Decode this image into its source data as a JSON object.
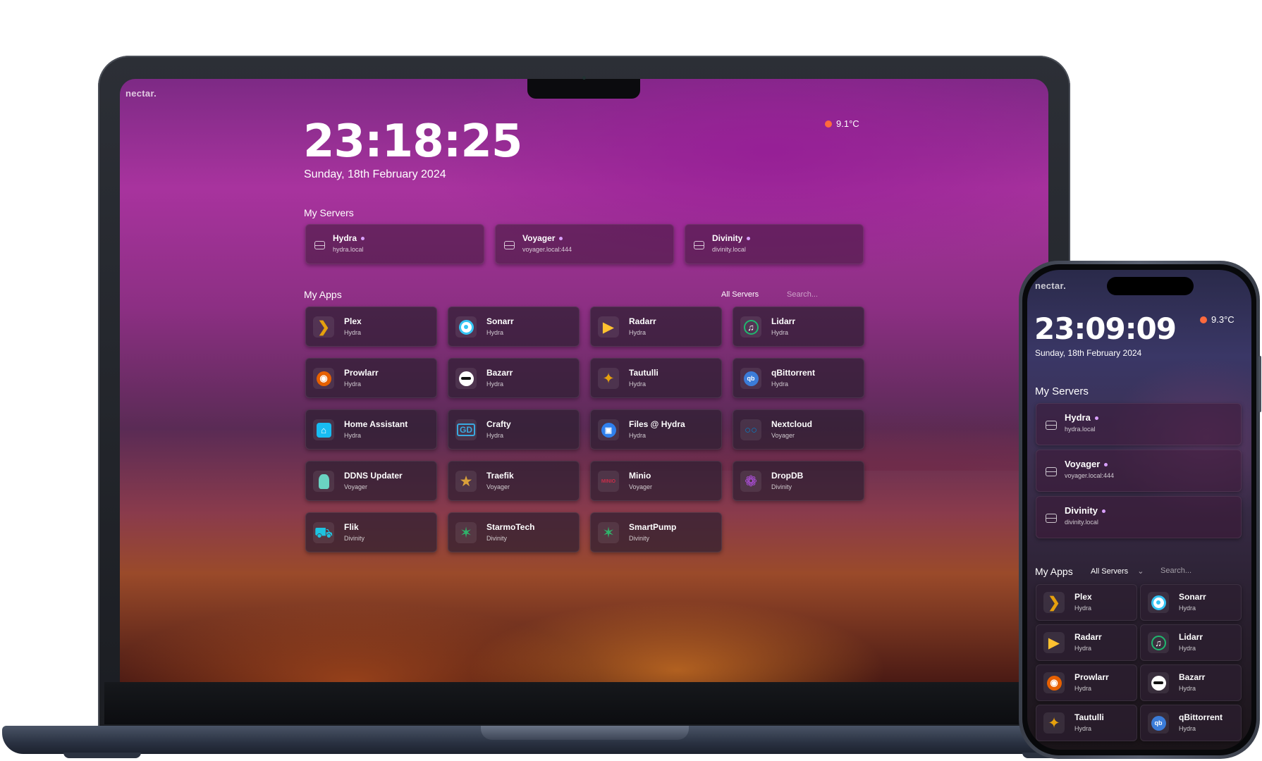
{
  "brand": "nectar.",
  "laptop": {
    "time": "23:18:25",
    "date": "Sunday, 18th February 2024",
    "weather": "9.1°C",
    "servers_title": "My Servers",
    "apps_title": "My Apps",
    "filter_label": "All Servers",
    "search_placeholder": "Search..."
  },
  "phone": {
    "time": "23:09:09",
    "date": "Sunday, 18th February 2024",
    "weather": "9.3°C",
    "servers_title": "My Servers",
    "apps_title": "My Apps",
    "filter_label": "All Servers",
    "search_placeholder": "Search..."
  },
  "servers": [
    {
      "name": "Hydra",
      "host": "hydra.local"
    },
    {
      "name": "Voyager",
      "host": "voyager.local:444"
    },
    {
      "name": "Divinity",
      "host": "divinity.local"
    }
  ],
  "apps": [
    {
      "name": "Plex",
      "server": "Hydra",
      "icon": "plex-icon",
      "color": "#e5a00d"
    },
    {
      "name": "Sonarr",
      "server": "Hydra",
      "icon": "sonarr-icon",
      "color": "#35c5f4"
    },
    {
      "name": "Radarr",
      "server": "Hydra",
      "icon": "radarr-icon",
      "color": "#ffc230"
    },
    {
      "name": "Lidarr",
      "server": "Hydra",
      "icon": "lidarr-icon",
      "color": "#1fb86f"
    },
    {
      "name": "Prowlarr",
      "server": "Hydra",
      "icon": "prowlarr-icon",
      "color": "#e66001"
    },
    {
      "name": "Bazarr",
      "server": "Hydra",
      "icon": "bazarr-icon",
      "color": "#ffffff"
    },
    {
      "name": "Tautulli",
      "server": "Hydra",
      "icon": "tautulli-icon",
      "color": "#e5a00d"
    },
    {
      "name": "qBittorrent",
      "server": "Hydra",
      "icon": "qbittorrent-icon",
      "color": "#3b7cd8"
    },
    {
      "name": "Home Assistant",
      "server": "Hydra",
      "icon": "home-assistant-icon",
      "color": "#18bcf2"
    },
    {
      "name": "Crafty",
      "server": "Hydra",
      "icon": "crafty-icon",
      "color": "#3aa9e0"
    },
    {
      "name": "Files @ Hydra",
      "server": "Hydra",
      "icon": "files-icon",
      "color": "#2f80ed"
    },
    {
      "name": "Nextcloud",
      "server": "Voyager",
      "icon": "nextcloud-icon",
      "color": "#0082c9"
    },
    {
      "name": "DDNS Updater",
      "server": "Voyager",
      "icon": "ddns-updater-icon",
      "color": "#6ad3c2"
    },
    {
      "name": "Traefik",
      "server": "Voyager",
      "icon": "traefik-icon",
      "color": "#d9a03a"
    },
    {
      "name": "Minio",
      "server": "Voyager",
      "icon": "minio-icon",
      "color": "#c72e49"
    },
    {
      "name": "DropDB",
      "server": "Divinity",
      "icon": "dropdb-icon",
      "color": "#b04fe0"
    },
    {
      "name": "Flik",
      "server": "Divinity",
      "icon": "flik-icon",
      "color": "#1ec3e0"
    },
    {
      "name": "StarmoTech",
      "server": "Divinity",
      "icon": "starmotech-icon",
      "color": "#2fb36a"
    },
    {
      "name": "SmartPump",
      "server": "Divinity",
      "icon": "smartpump-icon",
      "color": "#2fb36a"
    }
  ]
}
